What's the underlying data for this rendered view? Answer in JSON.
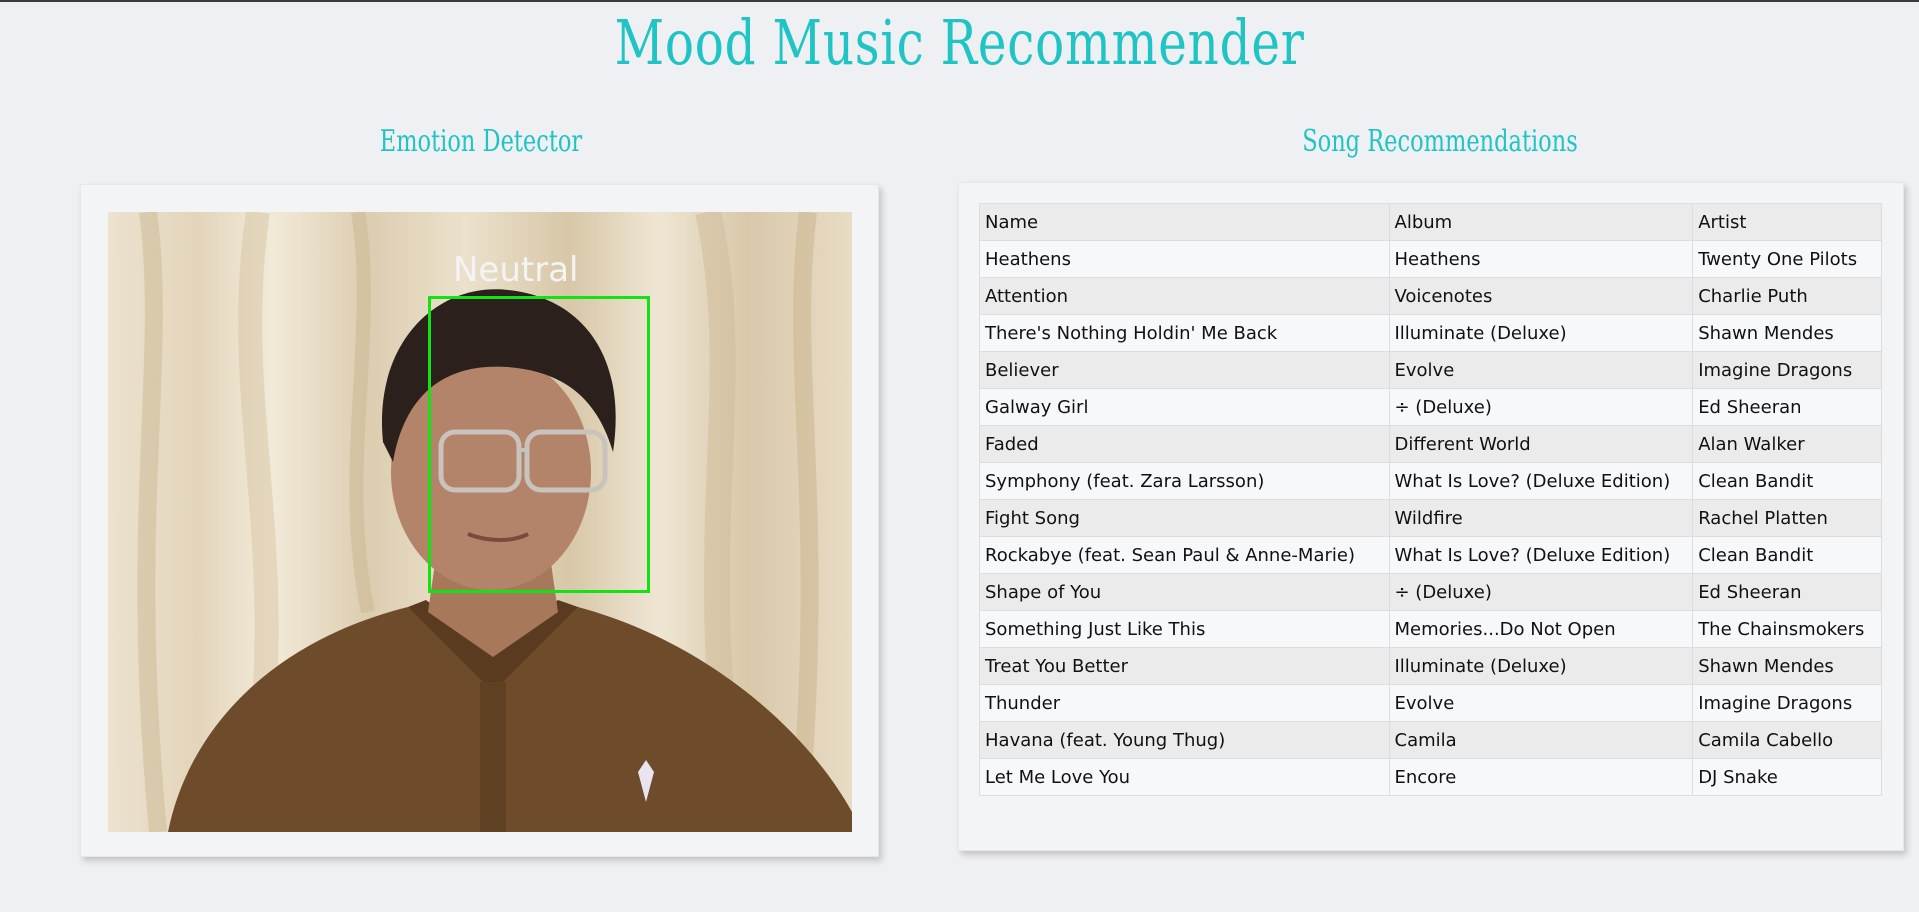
{
  "app": {
    "title": "Mood Music Recommender"
  },
  "emotion_detector": {
    "title": "Emotion Detector",
    "detected_emotion": "Neutral",
    "box_color": "#12e312"
  },
  "recommendations": {
    "title": "Song Recommendations",
    "columns": [
      "Name",
      "Album",
      "Artist"
    ],
    "rows": [
      [
        "Heathens",
        "Heathens",
        "Twenty One Pilots"
      ],
      [
        "Attention",
        "Voicenotes",
        "Charlie Puth"
      ],
      [
        "There's Nothing Holdin' Me Back",
        "Illuminate (Deluxe)",
        "Shawn Mendes"
      ],
      [
        "Believer",
        "Evolve",
        "Imagine Dragons"
      ],
      [
        "Galway Girl",
        "÷ (Deluxe)",
        "Ed Sheeran"
      ],
      [
        "Faded",
        "Different World",
        "Alan Walker"
      ],
      [
        "Symphony (feat. Zara Larsson)",
        "What Is Love? (Deluxe Edition)",
        "Clean Bandit"
      ],
      [
        "Fight Song",
        "Wildfire",
        "Rachel Platten"
      ],
      [
        "Rockabye (feat. Sean Paul & Anne-Marie)",
        "What Is Love? (Deluxe Edition)",
        "Clean Bandit"
      ],
      [
        "Shape of You",
        "÷ (Deluxe)",
        "Ed Sheeran"
      ],
      [
        "Something Just Like This",
        "Memories...Do Not Open",
        "The Chainsmokers"
      ],
      [
        "Treat You Better",
        "Illuminate (Deluxe)",
        "Shawn Mendes"
      ],
      [
        "Thunder",
        "Evolve",
        "Imagine Dragons"
      ],
      [
        "Havana (feat. Young Thug)",
        "Camila",
        "Camila Cabello"
      ],
      [
        "Let Me Love You",
        "Encore",
        "DJ Snake"
      ]
    ]
  },
  "colors": {
    "accent": "#20c4c4",
    "background": "#eff0f3"
  }
}
